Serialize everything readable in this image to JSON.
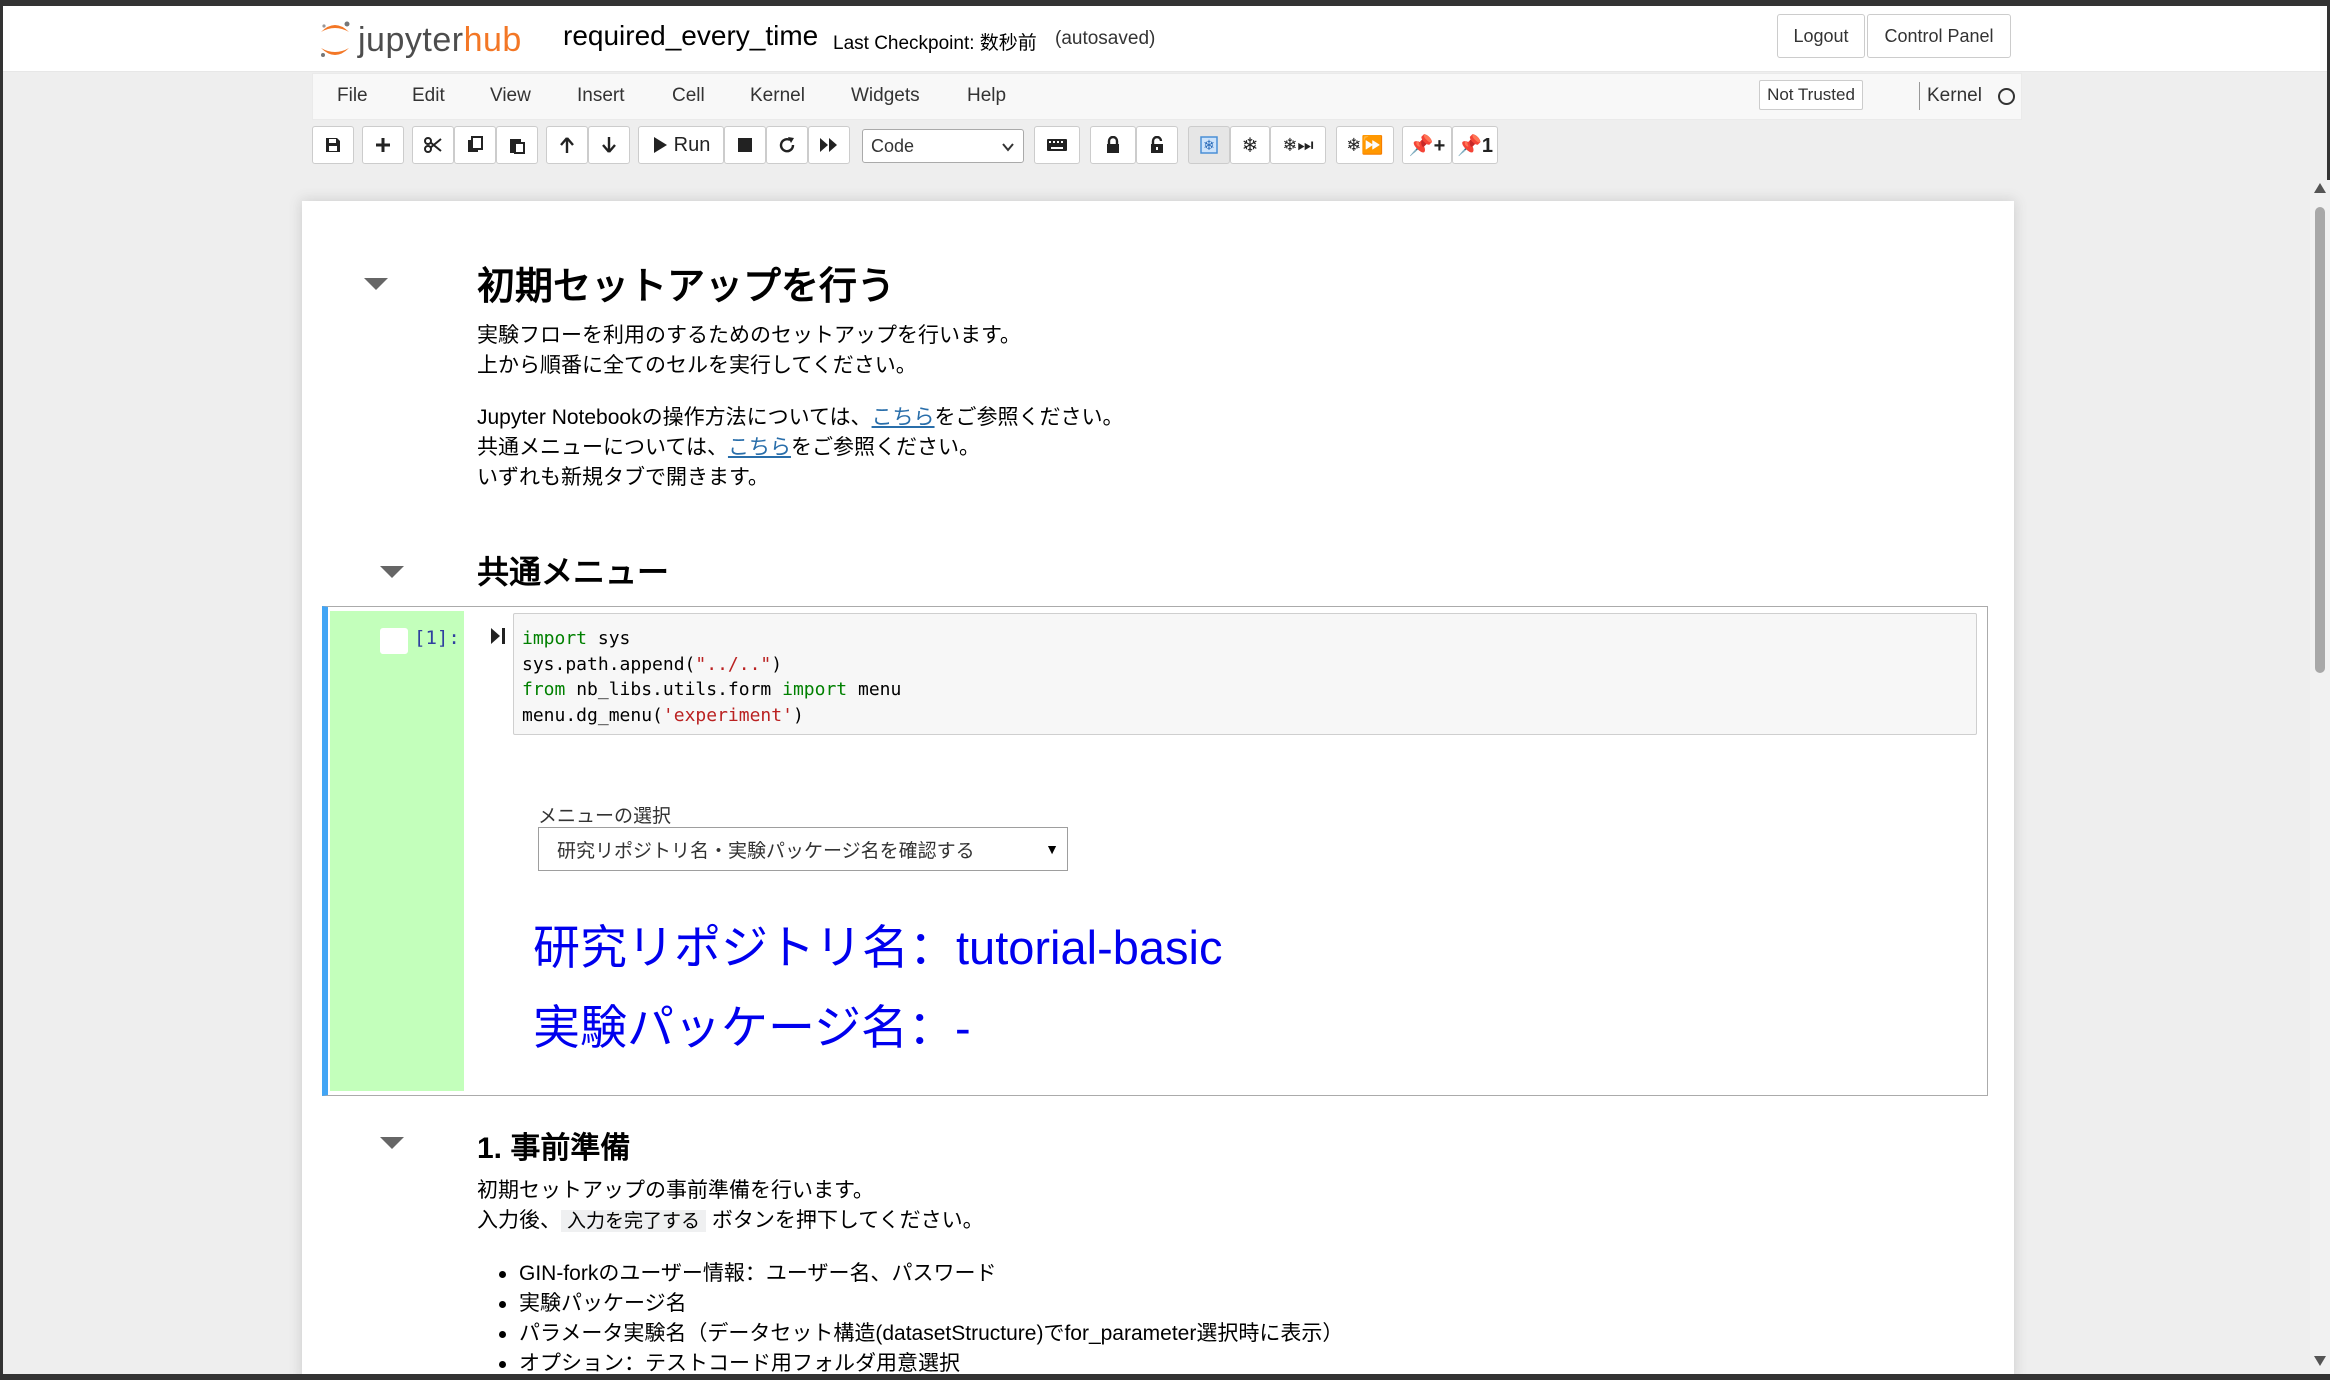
{
  "header": {
    "logo_jupyter": "jupyter",
    "logo_hub": "hub",
    "notebook_name": "required_every_time",
    "checkpoint": "Last Checkpoint: 数秒前",
    "autosave": "(autosaved)",
    "logout": "Logout",
    "control_panel": "Control Panel"
  },
  "menubar": {
    "items": [
      "File",
      "Edit",
      "View",
      "Insert",
      "Cell",
      "Kernel",
      "Widgets",
      "Help"
    ],
    "trusted": "Not Trusted",
    "kernel": "Kernel"
  },
  "toolbar": {
    "run_label": "Run",
    "cell_type": "Code",
    "icons": [
      "save-icon",
      "plus-icon",
      "cut-icon",
      "copy-icon",
      "paste-icon",
      "arrow-up-icon",
      "arrow-down-icon",
      "run-icon",
      "stop-icon",
      "restart-icon",
      "fast-forward-icon",
      "keyboard-icon",
      "lock-icon",
      "unlock-icon",
      "snowflake-icon",
      "snowflake-icon",
      "snowflake-next-icon",
      "snowflake-forward-icon",
      "pin-plus-icon",
      "pin-one-icon"
    ]
  },
  "notebook": {
    "section1": {
      "title": "初期セットアップを行う",
      "p1_line1": "実験フローを利用のするためのセットアップを行います。",
      "p1_line2": "上から順番に全てのセルを実行してください。",
      "p2_line1_pre": "Jupyter Notebookの操作方法については、",
      "p2_line1_link": "こちら",
      "p2_line1_post": "をご参照ください。",
      "p2_line2_pre": "共通メニューについては、",
      "p2_line2_link": "こちら",
      "p2_line2_post": "をご参照ください。",
      "p2_line3": "いずれも新規タブで開きます。"
    },
    "section2": {
      "title": "共通メニュー"
    },
    "code_cell": {
      "prompt": "[1]:",
      "code": {
        "l1_kw": "import",
        "l1_rest": " sys",
        "l2_pre": "sys.path.append(",
        "l2_str": "\"../..\"",
        "l2_post": ")",
        "l3_kw1": "from",
        "l3_mid": " nb_libs.utils.form ",
        "l3_kw2": "import",
        "l3_rest": " menu",
        "l4_pre": "menu.dg_menu(",
        "l4_str": "'experiment'",
        "l4_post": ")"
      },
      "widget_label": "メニューの選択",
      "widget_selected": "研究リポジトリ名・実験パッケージ名を確認する",
      "output_line1": "研究リポジトリ名：tutorial-basic",
      "output_line2": "実験パッケージ名：-"
    },
    "section3": {
      "title": "1. 事前準備",
      "p_line1": "初期セットアップの事前準備を行います。",
      "p_line2_pre": "入力後、",
      "p_line2_code": "入力を完了する",
      "p_line2_post": "ボタンを押下してください。",
      "bullets": [
        "GIN-forkのユーザー情報：ユーザー名、パスワード",
        "実験パッケージ名",
        "パラメータ実験名（データセット構造(datasetStructure)でfor_parameter選択時に表示）",
        "オプション：テストコード用フォルダ用意選択"
      ]
    }
  },
  "colors": {
    "accent_blue": "#42a5f5",
    "prompt_bg": "#c3ffbb",
    "output_text": "#0000ee",
    "link": "#296eaa",
    "logo_orange": "#f37726"
  }
}
